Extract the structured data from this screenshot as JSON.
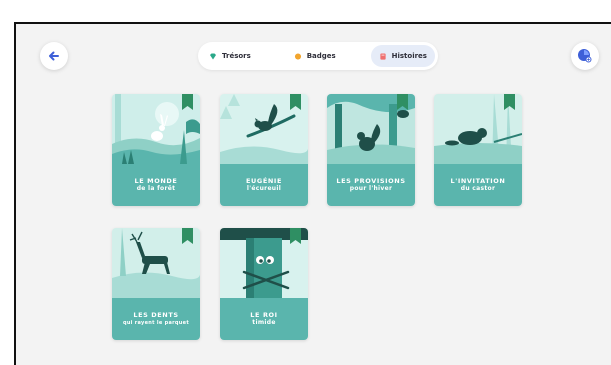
{
  "tabs": [
    {
      "label": "Trésors",
      "icon": "gem-icon",
      "color": "#2aa889"
    },
    {
      "label": "Badges",
      "icon": "coin-icon",
      "color": "#f2a52e"
    },
    {
      "label": "Histoires",
      "icon": "book-icon",
      "color": "#ef6f6f"
    }
  ],
  "colors": {
    "background": "#f3f3f3",
    "label_teal": "#5ab5ad",
    "bookmark_green": "#2f8f63",
    "accent_blue": "#3d5fd8"
  },
  "stories": [
    {
      "title": "LE MONDE",
      "subtitle": "de la forêt"
    },
    {
      "title": "EUGÉNIE",
      "subtitle": "l'écureuil"
    },
    {
      "title": "LES PROVISIONS",
      "subtitle": "pour l'hiver"
    },
    {
      "title": "L'INVITATION",
      "subtitle": "du castor"
    },
    {
      "title": "LES DENTS",
      "subtitle": "qui rayent le parquet"
    },
    {
      "title": "LE ROI",
      "subtitle": "timide"
    }
  ]
}
